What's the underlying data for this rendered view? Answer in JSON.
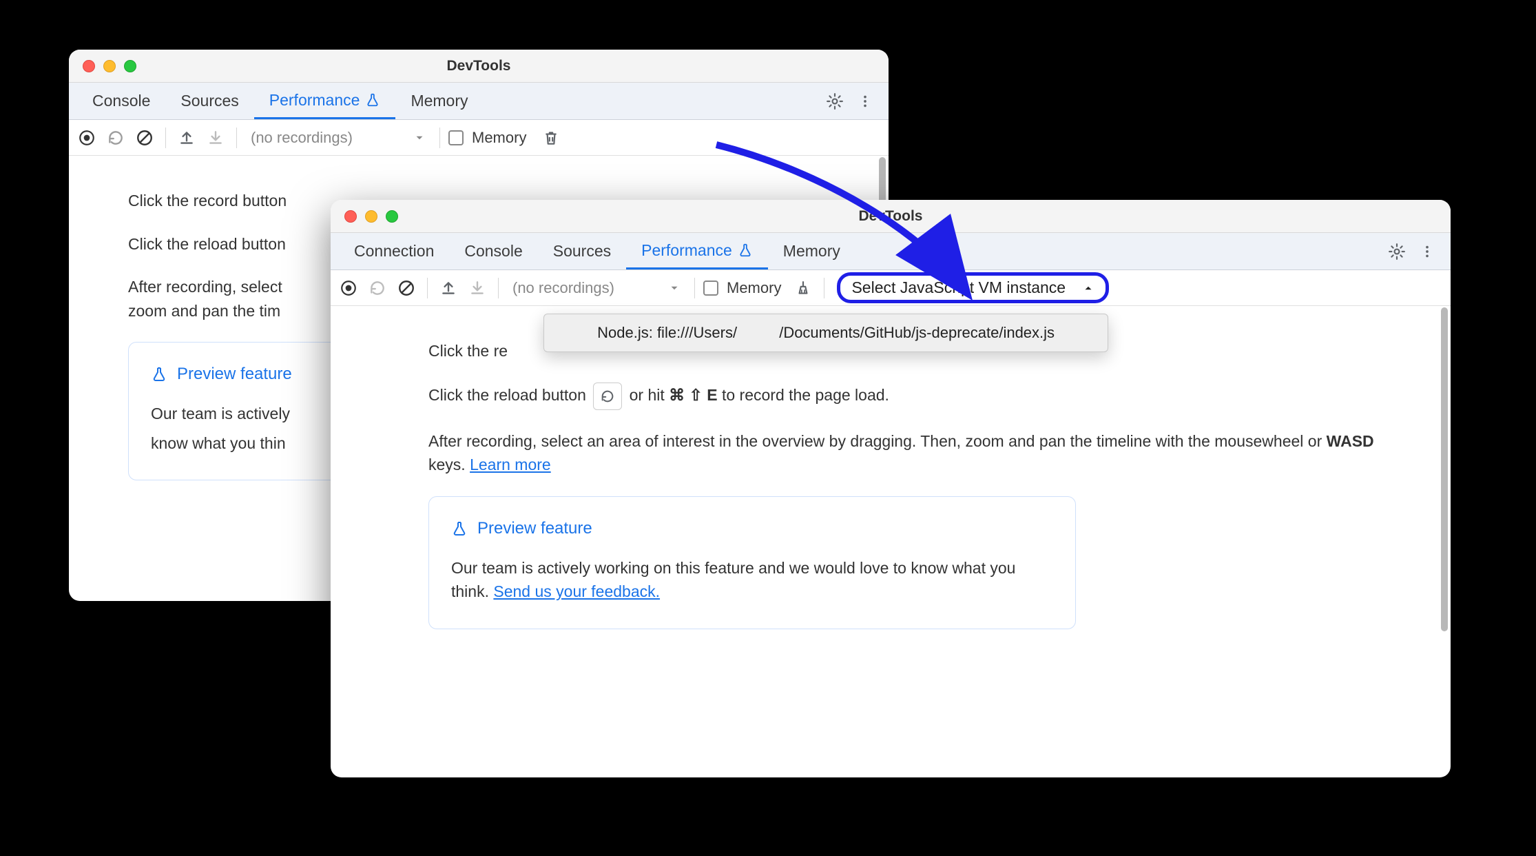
{
  "window_back": {
    "title": "DevTools",
    "tabs": {
      "console": "Console",
      "sources": "Sources",
      "performance": "Performance",
      "memory": "Memory"
    },
    "toolbar": {
      "recordings_placeholder": "(no recordings)",
      "memory_label": "Memory"
    },
    "content": {
      "record_line_prefix": "Click the record button",
      "reload_line_prefix": "Click the reload button",
      "after_line_1": "After recording, select",
      "after_line_2": "zoom and pan the tim",
      "preview_label": "Preview feature",
      "team_line_1": "Our team is actively",
      "team_line_2": "know what you thin"
    }
  },
  "window_front": {
    "title": "DevTools",
    "tabs": {
      "connection": "Connection",
      "console": "Console",
      "sources": "Sources",
      "performance": "Performance",
      "memory": "Memory"
    },
    "toolbar": {
      "recordings_placeholder": "(no recordings)",
      "memory_label": "Memory",
      "vm_select_label": "Select JavaScript VM instance",
      "vm_dropdown_item": "Node.js: file:///Users/          /Documents/GitHub/js-deprecate/index.js"
    },
    "content": {
      "record_line_prefix": "Click the re",
      "reload_line_prefix": "Click the reload button",
      "reload_line_suffix_a": "or hit",
      "reload_key_cmd": "⌘ ⇧ E",
      "reload_line_suffix_b": "to record the page load.",
      "after_line": "After recording, select an area of interest in the overview by dragging. Then, zoom and pan the timeline with the mousewheel or ",
      "wasd": "WASD",
      "after_line_tail": " keys. ",
      "learn_more": "Learn more",
      "preview_label": "Preview feature",
      "team_line": "Our team is actively working on this feature and we would love to know what you think. ",
      "feedback_link": "Send us your feedback."
    }
  },
  "icon_names": {
    "record": "record-icon",
    "reload": "reload-icon",
    "clear": "clear-icon",
    "upload": "upload-icon",
    "download": "download-icon",
    "trash": "trash-icon",
    "settings": "gear-icon",
    "more": "more-vert-icon",
    "flask": "flask-icon",
    "broom": "broom-icon",
    "caret": "caret-icon"
  }
}
